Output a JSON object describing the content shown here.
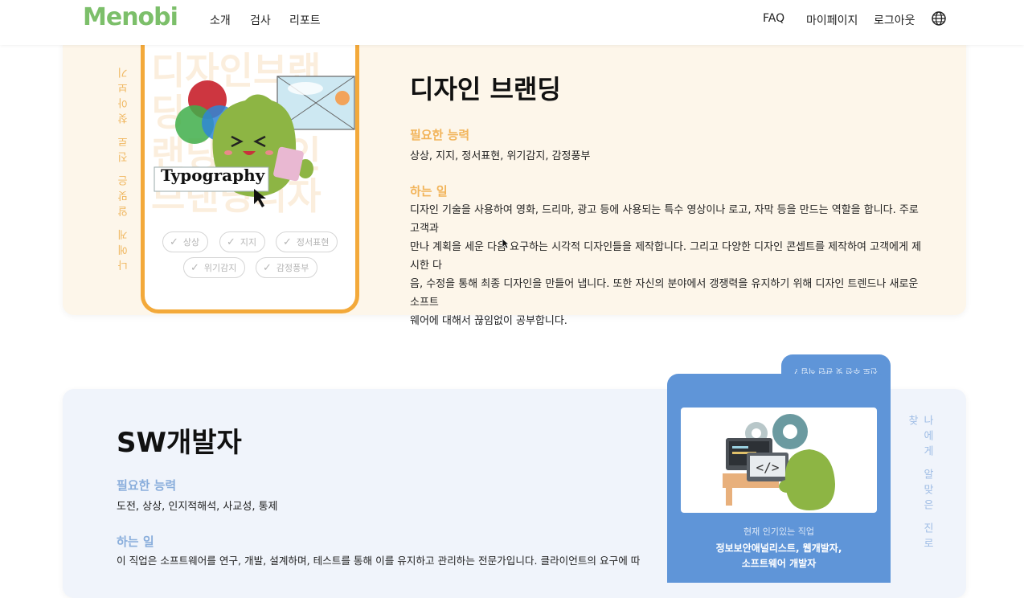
{
  "header": {
    "logo": "Menobi",
    "nav_left": [
      "소개",
      "검사",
      "리포트"
    ],
    "nav_right": [
      "FAQ",
      "마이페이지",
      "로그아웃"
    ]
  },
  "card1": {
    "side_text": "나에게 알맞은 진로 찾아보기",
    "bg_words": [
      "디자인브랜",
      "딩",
      "랜딩디자인",
      "브랜딩디자"
    ],
    "illustration_text": "Typography",
    "chips": [
      "상상",
      "지지",
      "정서표현",
      "위기감지",
      "감정풍부"
    ],
    "title": "디자인 브랜딩",
    "abilities_label": "필요한 능력",
    "abilities": "상상,  지지,  정서표현,  위기감지,  감정풍부",
    "work_label": "하는 일",
    "work_lines": [
      "디자인 기술을 사용하여 영화, 드리마, 광고 등에 사용되는 특수 영상이나 로고, 자막 등을 만드는 역할을 합니다. 주로 고객과",
      "만나 계획을 세운 다음 요구하는 시각적 디자인들을 제작합니다. 그리고 다양한 디자인 콘셉트를 제작하여 고객에게 제시한 다",
      "음, 수정을 통해 최종 디자인을 만들어 냅니다. 또한 자신의 분야에서 갱쟁력을 유지하기 위해 디자인 트렌드나 새로운 소프트",
      "웨어에 대해서 끊임없이 공부합니다."
    ]
  },
  "card2": {
    "title": "SW개발자",
    "abilities_label": "필요한 능력",
    "abilities": "도전,  상상,  인지적해석,  사교성,  통제",
    "work_label": "하는 일",
    "work_line": "이 직업은 소프트웨어를 연구, 개발, 설계하며, 테스트를 통해 이를 유지하고 관리하는 전문가입니다. 클라이언트의 요구에 따",
    "tab_text": "진로 추천 및 관련 직업 ?",
    "popular_label": "현재 인기있는 직업",
    "popular_jobs": [
      "정보보안애널리스트, 웹개발자,",
      "소프트웨어 개발자"
    ],
    "side_text": "나에게 알맞은 진로 찾"
  },
  "colors": {
    "logo": "#7cbf6a",
    "orange_accent": "#f3a93a",
    "blue_card": "#5f95d8",
    "card1_bg": "#fdf6ea",
    "card2_bg": "#f0f4fb"
  }
}
